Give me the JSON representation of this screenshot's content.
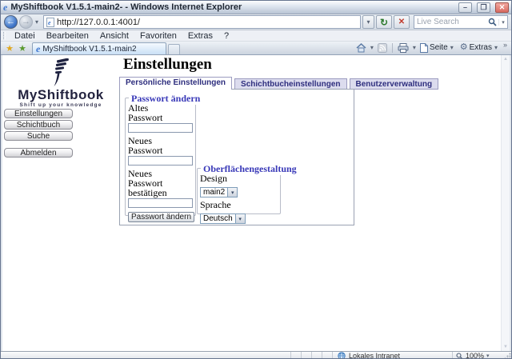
{
  "window": {
    "title": "MyShiftbook V1.5.1-main2- - Windows Internet Explorer"
  },
  "icons": {
    "minimize": "–",
    "maximize": "❐",
    "close": "✕",
    "back": "←",
    "forward": "→",
    "dropdown": "▾",
    "refresh": "↻",
    "stop": "✕",
    "favorites": "★",
    "add_favorite": "★",
    "chevron": "»",
    "gear": "⚙",
    "ie_logo": "e",
    "scroll_up": "▲",
    "scroll_down": "▼"
  },
  "navbar": {
    "url": "http://127.0.0.1:4001/",
    "search_placeholder": "Live Search"
  },
  "menubar": {
    "items": [
      "Datei",
      "Bearbeiten",
      "Ansicht",
      "Favoriten",
      "Extras",
      "?"
    ]
  },
  "tabbar": {
    "tab_title": "MyShiftbook V1.5.1-main2",
    "page_button": "Seite",
    "extras_button": "Extras"
  },
  "page": {
    "sidebar": {
      "logo_title": "MyShiftbook",
      "logo_tagline": "Shift up your knowledge",
      "buttons": [
        "Einstellungen",
        "Schichtbuch",
        "Suche"
      ],
      "logout": "Abmelden"
    },
    "main": {
      "title": "Einstellungen",
      "tabs": [
        {
          "label": "Persönliche Einstellungen",
          "active": true
        },
        {
          "label": "Schichtbucheinstellungen",
          "active": false
        },
        {
          "label": "Benutzerverwaltung",
          "active": false
        }
      ],
      "password": {
        "legend": "Passwort ändern",
        "old_label": "Altes Passwort",
        "new_label": "Neues Passwort",
        "confirm_label": "Neues Passwort bestätigen",
        "submit": "Passwort ändern"
      },
      "appearance": {
        "legend": "Oberflächengestaltung",
        "design_label": "Design",
        "design_value": "main2",
        "language_label": "Sprache",
        "language_value": "Deutsch"
      }
    }
  },
  "statusbar": {
    "zone": "Lokales Intranet",
    "zoom": "100%"
  },
  "colors": {
    "tab_inactive_bg": "#dcdcee",
    "tab_text": "#2e2e7e",
    "legend_blue": "#3939b8",
    "logo_navy": "#23233f"
  }
}
